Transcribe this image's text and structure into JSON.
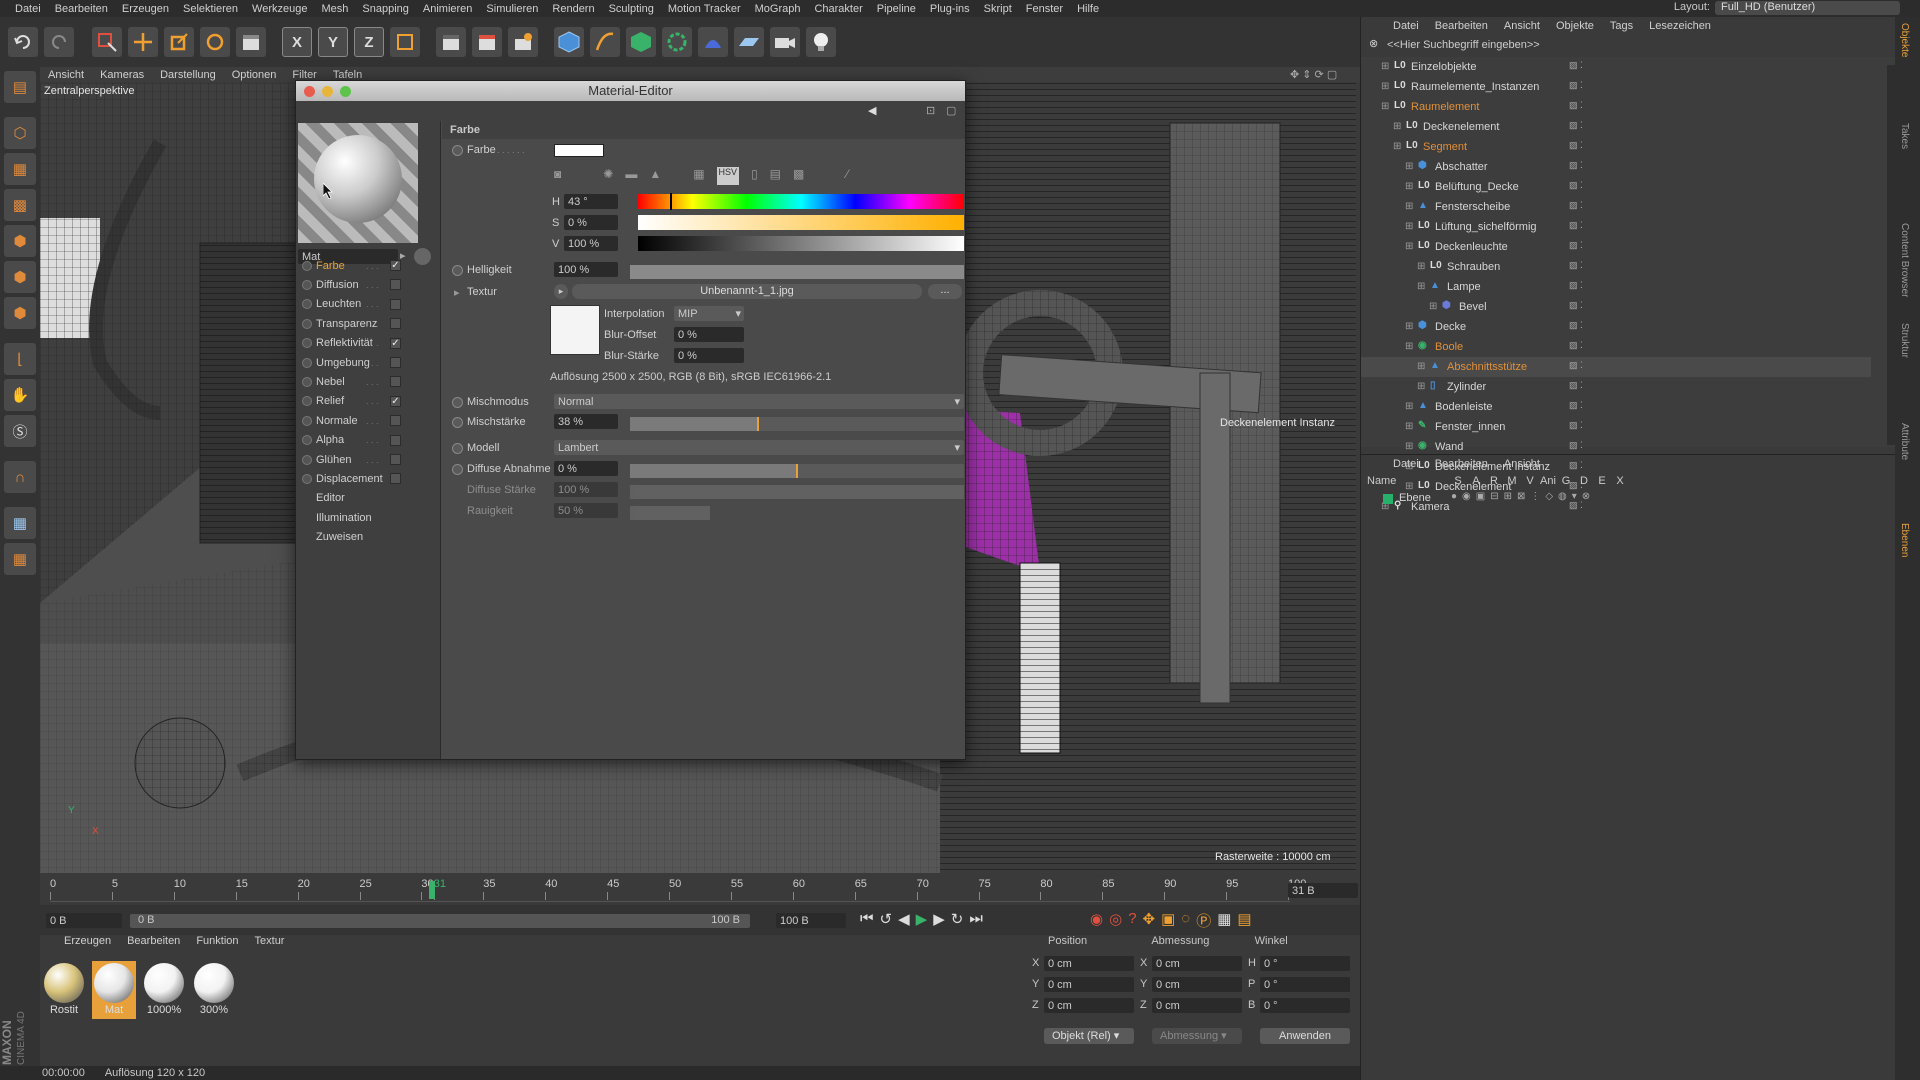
{
  "menubar": {
    "items": [
      "Datei",
      "Bearbeiten",
      "Erzeugen",
      "Selektieren",
      "Werkzeuge",
      "Mesh",
      "Snapping",
      "Animieren",
      "Simulieren",
      "Rendern",
      "Sculpting",
      "Motion Tracker",
      "MoGraph",
      "Charakter",
      "Pipeline",
      "Plug-ins",
      "Skript",
      "Fenster",
      "Hilfe"
    ],
    "layout_label": "Layout:",
    "layout_value": "Full_HD (Benutzer)"
  },
  "toolbar": {
    "axis_x": "X",
    "axis_y": "Y",
    "axis_z": "Z"
  },
  "viewport": {
    "menu": [
      "Ansicht",
      "Kameras",
      "Darstellung",
      "Optionen",
      "Filter",
      "Tafeln"
    ],
    "label": "Zentralperspektive",
    "object_label": "Deckenelement Instanz",
    "grid_info": "Rasterweite : 10000 cm",
    "axis_y": "Y",
    "axis_x": "X"
  },
  "material_editor": {
    "title": "Material-Editor",
    "mat_name": "Mat",
    "channels": [
      {
        "label": "Farbe",
        "checked": true,
        "active": true
      },
      {
        "label": "Diffusion",
        "checked": false
      },
      {
        "label": "Leuchten",
        "checked": false
      },
      {
        "label": "Transparenz",
        "checked": false
      },
      {
        "label": "Reflektivität",
        "checked": true
      },
      {
        "label": "Umgebung",
        "checked": false
      },
      {
        "label": "Nebel",
        "checked": false
      },
      {
        "label": "Relief",
        "checked": true
      },
      {
        "label": "Normale",
        "checked": false
      },
      {
        "label": "Alpha",
        "checked": false
      },
      {
        "label": "Glühen",
        "checked": false
      },
      {
        "label": "Displacement",
        "checked": false
      }
    ],
    "extra": [
      "Editor",
      "Illumination",
      "Zuweisen"
    ],
    "section": "Farbe",
    "farbe_label": "Farbe",
    "h_label": "H",
    "h_value": "43 °",
    "s_label": "S",
    "s_value": "0 %",
    "v_label": "V",
    "v_value": "100 %",
    "helligkeit_label": "Helligkeit",
    "helligkeit_value": "100 %",
    "textur_label": "Textur",
    "textur_file": "Unbenannt-1_1.jpg",
    "textur_btn": "...",
    "interpolation_label": "Interpolation",
    "interpolation_value": "MIP",
    "blur_offset_label": "Blur-Offset",
    "blur_offset_value": "0 %",
    "blur_staerke_label": "Blur-Stärke",
    "blur_staerke_value": "0 %",
    "resolution_info": "Auflösung 2500 x 2500, RGB (8 Bit), sRGB IEC61966-2.1",
    "mischmodus_label": "Mischmodus",
    "mischmodus_value": "Normal",
    "mischstaerke_label": "Mischstärke",
    "mischstaerke_value": "38 %",
    "mischstaerke_level": 0.38,
    "modell_label": "Modell",
    "modell_value": "Lambert",
    "diffuse_abnahme_label": "Diffuse Abnahme",
    "diffuse_abnahme_value": "0 %",
    "diffuse_staerke_label": "Diffuse Stärke",
    "diffuse_staerke_value": "100 %",
    "rauigkeit_label": "Rauigkeit",
    "rauigkeit_value": "50 %",
    "hsv_btn": "HSV"
  },
  "timeline": {
    "ticks": [
      "0",
      "5",
      "10",
      "15",
      "20",
      "25",
      "30",
      "31",
      "35",
      "40",
      "45",
      "50",
      "55",
      "60",
      "65",
      "70",
      "75",
      "80",
      "85",
      "90",
      "95",
      "100"
    ],
    "current_frame": "31 B",
    "start": "0 B",
    "range_start": "0 B",
    "range_end": "100 B",
    "end": "100 B"
  },
  "material_manager": {
    "menu": [
      "Erzeugen",
      "Bearbeiten",
      "Funktion",
      "Textur"
    ],
    "materials": [
      {
        "name": "Rostit",
        "color": "#d8c37a"
      },
      {
        "name": "Mat",
        "color": "#e6e6e6"
      },
      {
        "name": "1000%",
        "color": "#f2f2f2"
      },
      {
        "name": "300%",
        "color": "#f2f2f2"
      }
    ],
    "brand1": "MAXON",
    "brand2": "CINEMA 4D"
  },
  "coordinates": {
    "headers": [
      "Position",
      "Abmessung",
      "Winkel"
    ],
    "rows": [
      {
        "a": "X",
        "av": "0 cm",
        "b": "X",
        "bv": "0 cm",
        "c": "H",
        "cv": "0 °"
      },
      {
        "a": "Y",
        "av": "0 cm",
        "b": "Y",
        "bv": "0 cm",
        "c": "P",
        "cv": "0 °"
      },
      {
        "a": "Z",
        "av": "0 cm",
        "b": "Z",
        "bv": "0 cm",
        "c": "B",
        "cv": "0 °"
      }
    ],
    "mode": "Objekt (Rel)",
    "size_mode": "Abmessung",
    "apply": "Anwenden"
  },
  "status": {
    "time": "00:00:00",
    "info": "Auflösung 120 x 120"
  },
  "object_manager": {
    "menu": [
      "Datei",
      "Bearbeiten",
      "Ansicht",
      "Objekte",
      "Tags",
      "Lesezeichen"
    ],
    "search_placeholder": "<<Hier Suchbegriff eingeben>>",
    "items": [
      {
        "name": "Einzelobjekte",
        "depth": 0,
        "color": "#d6d6d6",
        "icon": "null-icon"
      },
      {
        "name": "Raumelemente_Instanzen",
        "depth": 0,
        "color": "#d6d6d6",
        "icon": "null-icon"
      },
      {
        "name": "Raumelement",
        "depth": 0,
        "color": "#e0903a",
        "icon": "null-icon"
      },
      {
        "name": "Deckenelement",
        "depth": 1,
        "color": "#d6d6d6",
        "icon": "null-icon"
      },
      {
        "name": "Segment",
        "depth": 1,
        "color": "#e0903a",
        "icon": "null-icon"
      },
      {
        "name": "Abschatter",
        "depth": 2,
        "color": "#d6d6d6",
        "icon": "cube-icon"
      },
      {
        "name": "Belüftung_Decke",
        "depth": 2,
        "color": "#d6d6d6",
        "icon": "null-icon"
      },
      {
        "name": "Fensterscheibe",
        "depth": 2,
        "color": "#d6d6d6",
        "icon": "poly-icon"
      },
      {
        "name": "Lüftung_sichelförmig",
        "depth": 2,
        "color": "#d6d6d6",
        "icon": "null-icon"
      },
      {
        "name": "Deckenleuchte",
        "depth": 2,
        "color": "#d6d6d6",
        "icon": "null-icon"
      },
      {
        "name": "Schrauben",
        "depth": 3,
        "color": "#d6d6d6",
        "icon": "null-icon"
      },
      {
        "name": "Lampe",
        "depth": 3,
        "color": "#d6d6d6",
        "icon": "poly-icon"
      },
      {
        "name": "Bevel",
        "depth": 4,
        "color": "#d6d6d6",
        "icon": "deformer-icon"
      },
      {
        "name": "Decke",
        "depth": 2,
        "color": "#d6d6d6",
        "icon": "cube-icon"
      },
      {
        "name": "Boole",
        "depth": 2,
        "color": "#e0903a",
        "icon": "boole-icon"
      },
      {
        "name": "Abschnittsstütze",
        "depth": 3,
        "color": "#e0903a",
        "icon": "poly-icon"
      },
      {
        "name": "Zylinder",
        "depth": 3,
        "color": "#d6d6d6",
        "icon": "cylinder-icon"
      },
      {
        "name": "Bodenleiste",
        "depth": 2,
        "color": "#d6d6d6",
        "icon": "poly-icon"
      },
      {
        "name": "Fenster_innen",
        "depth": 2,
        "color": "#d6d6d6",
        "icon": "spline-icon"
      },
      {
        "name": "Wand",
        "depth": 2,
        "color": "#d6d6d6",
        "icon": "boole-icon"
      },
      {
        "name": "Deckenelement Instanz",
        "depth": 2,
        "color": "#d6d6d6",
        "icon": "null-icon"
      },
      {
        "name": "Deckenelement",
        "depth": 2,
        "color": "#d6d6d6",
        "icon": "null-icon"
      },
      {
        "name": "Kamera",
        "depth": 0,
        "color": "#d6d6d6",
        "icon": "camera-icon"
      }
    ]
  },
  "layer_manager": {
    "menu": [
      "Datei",
      "Bearbeiten",
      "Ansicht"
    ],
    "columns": [
      "Name",
      "S",
      "A",
      "R",
      "M",
      "V",
      "Ani",
      "G",
      "D",
      "E",
      "X"
    ],
    "layer_name": "Ebene",
    "layer_color": "#27b06a"
  },
  "side_tabs": [
    "Objekte",
    "Takes",
    "Content Browser",
    "Struktur",
    "Attribute",
    "Ebenen"
  ],
  "colors": {
    "accent": "#e0903a",
    "ui_bg": "#3a3a3a",
    "active_tab": "#e8a13a"
  }
}
